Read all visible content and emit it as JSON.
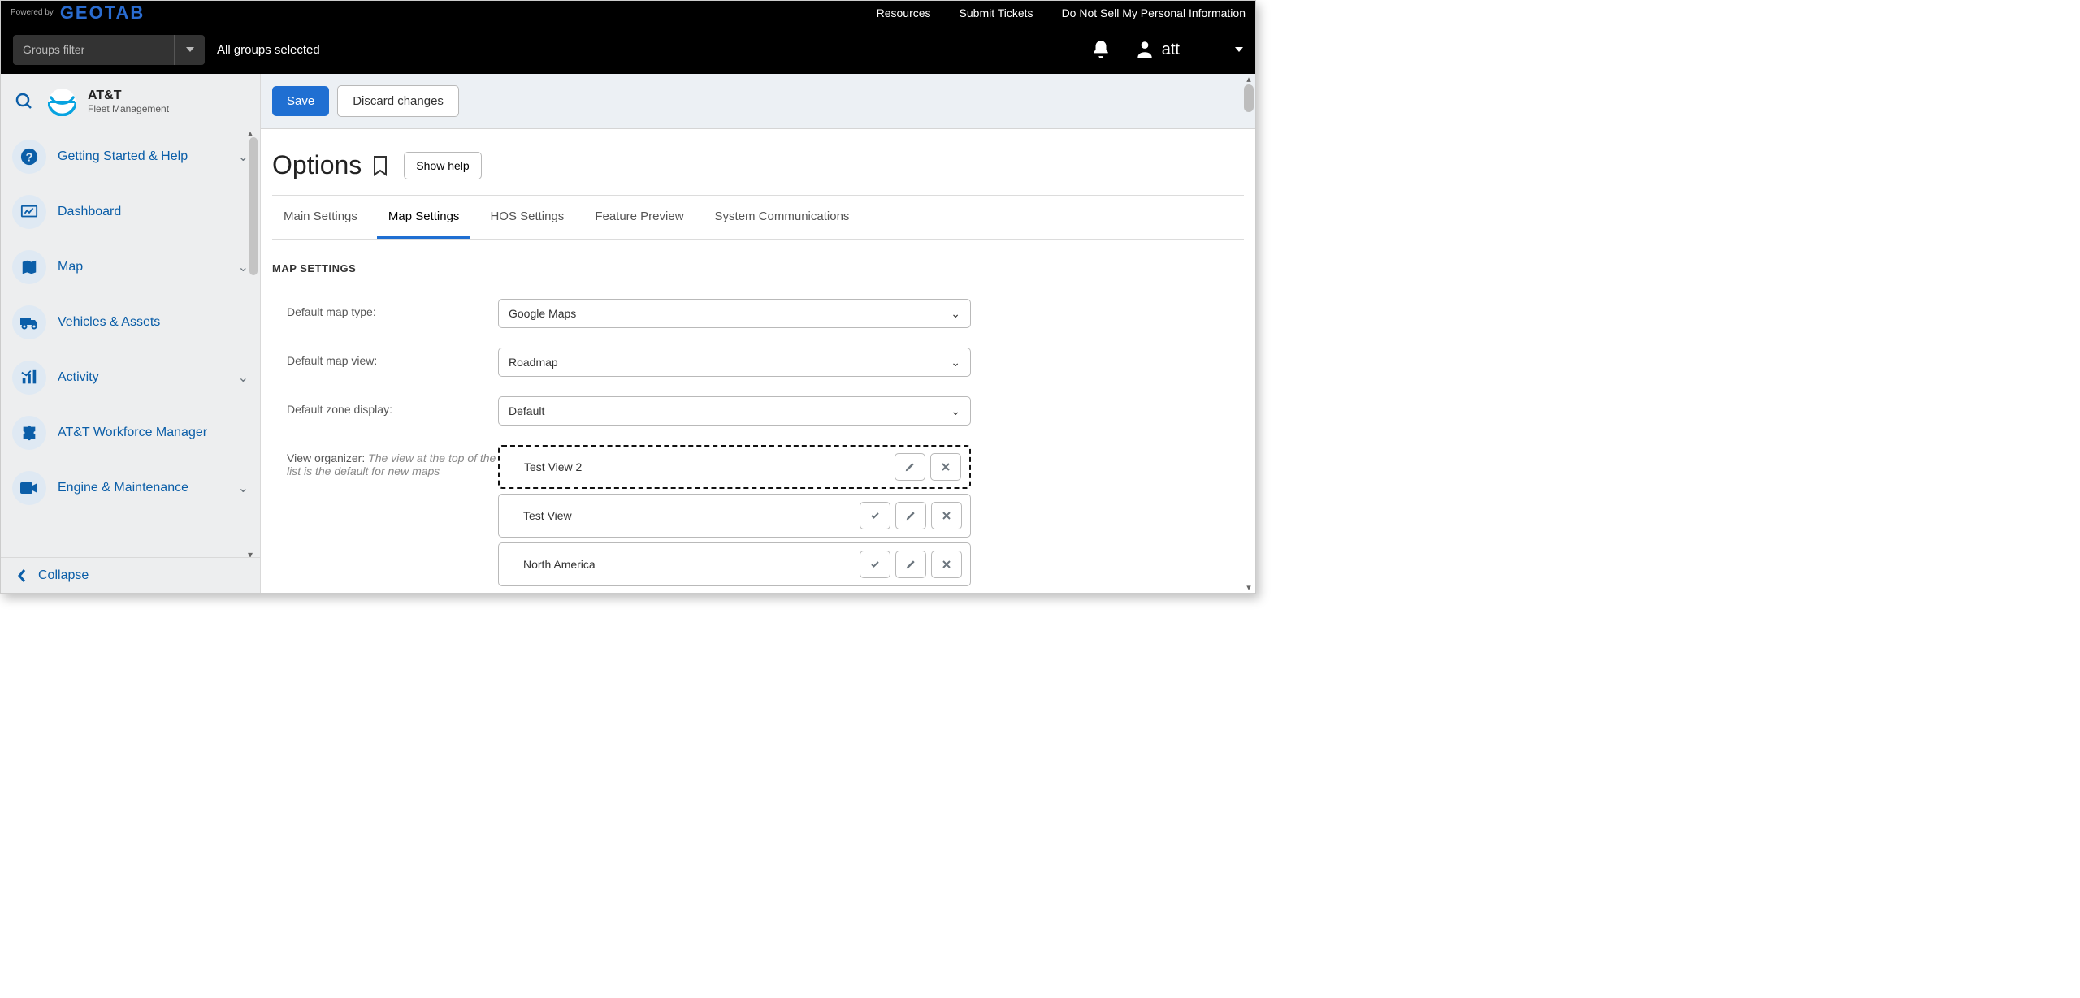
{
  "brand": {
    "powered_by": "Powered by",
    "logo_text": "GEOTAB"
  },
  "toplinks": {
    "resources": "Resources",
    "tickets": "Submit Tickets",
    "dns": "Do Not Sell My Personal Information"
  },
  "groups_filter": {
    "placeholder": "Groups filter",
    "status": "All groups selected"
  },
  "user": {
    "name": "att"
  },
  "product": {
    "name": "AT&T",
    "sub": "Fleet Management"
  },
  "sidebar": {
    "items": [
      {
        "label": "Getting Started & Help",
        "expandable": true
      },
      {
        "label": "Dashboard",
        "expandable": false
      },
      {
        "label": "Map",
        "expandable": true
      },
      {
        "label": "Vehicles & Assets",
        "expandable": false
      },
      {
        "label": "Activity",
        "expandable": true
      },
      {
        "label": "AT&T Workforce Manager",
        "expandable": false
      },
      {
        "label": "Engine & Maintenance",
        "expandable": true
      }
    ],
    "collapse": "Collapse"
  },
  "actions": {
    "save": "Save",
    "discard": "Discard changes"
  },
  "page": {
    "title": "Options",
    "show_help": "Show help"
  },
  "tabs": {
    "main": "Main Settings",
    "map": "Map Settings",
    "hos": "HOS Settings",
    "feature": "Feature Preview",
    "syscomm": "System Communications"
  },
  "section": {
    "title": "MAP SETTINGS"
  },
  "fields": {
    "map_type": {
      "label": "Default map type:",
      "value": "Google Maps"
    },
    "map_view": {
      "label": "Default map view:",
      "value": "Roadmap"
    },
    "zone": {
      "label": "Default zone display:",
      "value": "Default"
    },
    "organizer": {
      "label": "View organizer: ",
      "hint": "The view at the top of the list is the default for new maps"
    }
  },
  "views": [
    {
      "name": "Test View 2",
      "is_default": true
    },
    {
      "name": "Test View",
      "is_default": false
    },
    {
      "name": "North America",
      "is_default": false
    }
  ]
}
